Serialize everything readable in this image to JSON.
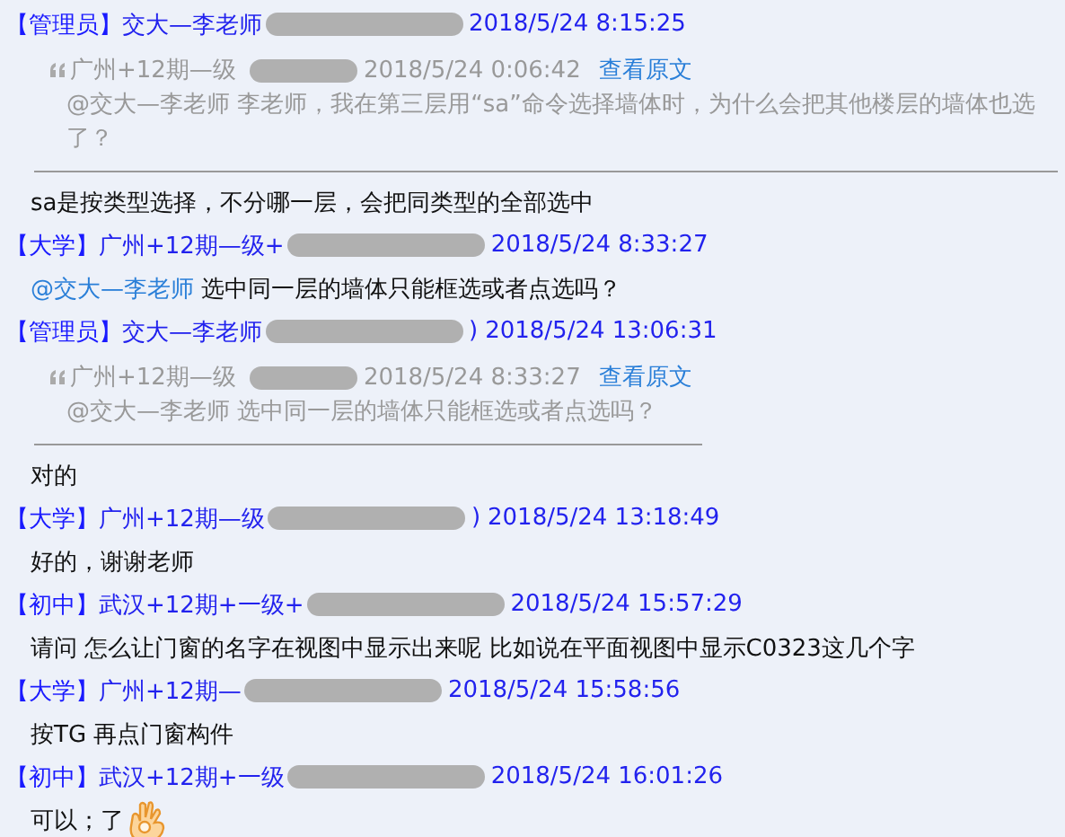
{
  "messages": [
    {
      "kind": "header",
      "tag": "【管理员】",
      "name": "交大—李老师",
      "time": "2018/5/24 8:15:25"
    },
    {
      "kind": "quote",
      "author": "广州+12期—级",
      "time": "2018/5/24 0:06:42",
      "link": "查看原文",
      "text": "@交大—李老师 李老师，我在第三层用“sa”命令选择墙体时，为什么会把其他楼层的墙体也选了？"
    },
    {
      "kind": "text",
      "text": "sa是按类型选择，不分哪一层，会把同类型的全部选中"
    },
    {
      "kind": "header",
      "tag": "【大学】",
      "name": "广州+12期—级+",
      "time": "2018/5/24 8:33:27"
    },
    {
      "kind": "mention",
      "mention": "@交大—李老师",
      "text": "选中同一层的墙体只能框选或者点选吗？"
    },
    {
      "kind": "header",
      "tag": "【管理员】",
      "name": "交大—李老师",
      "tail": ")",
      "time": "2018/5/24 13:06:31"
    },
    {
      "kind": "quote",
      "author": "广州+12期—级",
      "time": "2018/5/24 8:33:27",
      "link": "查看原文",
      "text": "@交大—李老师 选中同一层的墙体只能框选或者点选吗？"
    },
    {
      "kind": "text",
      "text": "对的"
    },
    {
      "kind": "header",
      "tag": "【大学】",
      "name": "广州+12期—级",
      "tail": ")",
      "time": "2018/5/24 13:18:49"
    },
    {
      "kind": "text",
      "text": "好的，谢谢老师"
    },
    {
      "kind": "header",
      "tag": "【初中】",
      "name": "武汉+12期+一级+",
      "time": "2018/5/24 15:57:29"
    },
    {
      "kind": "text",
      "text": "请问 怎么让门窗的名字在视图中显示出来呢   比如说在平面视图中显示C0323这几个字"
    },
    {
      "kind": "header",
      "tag": "【大学】",
      "name": "广州+12期—",
      "time": "2018/5/24 15:58:56"
    },
    {
      "kind": "text",
      "text": "按TG 再点门窗构件"
    },
    {
      "kind": "header",
      "tag": "【初中】",
      "name": "武汉+12期+一级",
      "time": "2018/5/24 16:01:26"
    },
    {
      "kind": "emoji",
      "text": "可以；了"
    }
  ]
}
